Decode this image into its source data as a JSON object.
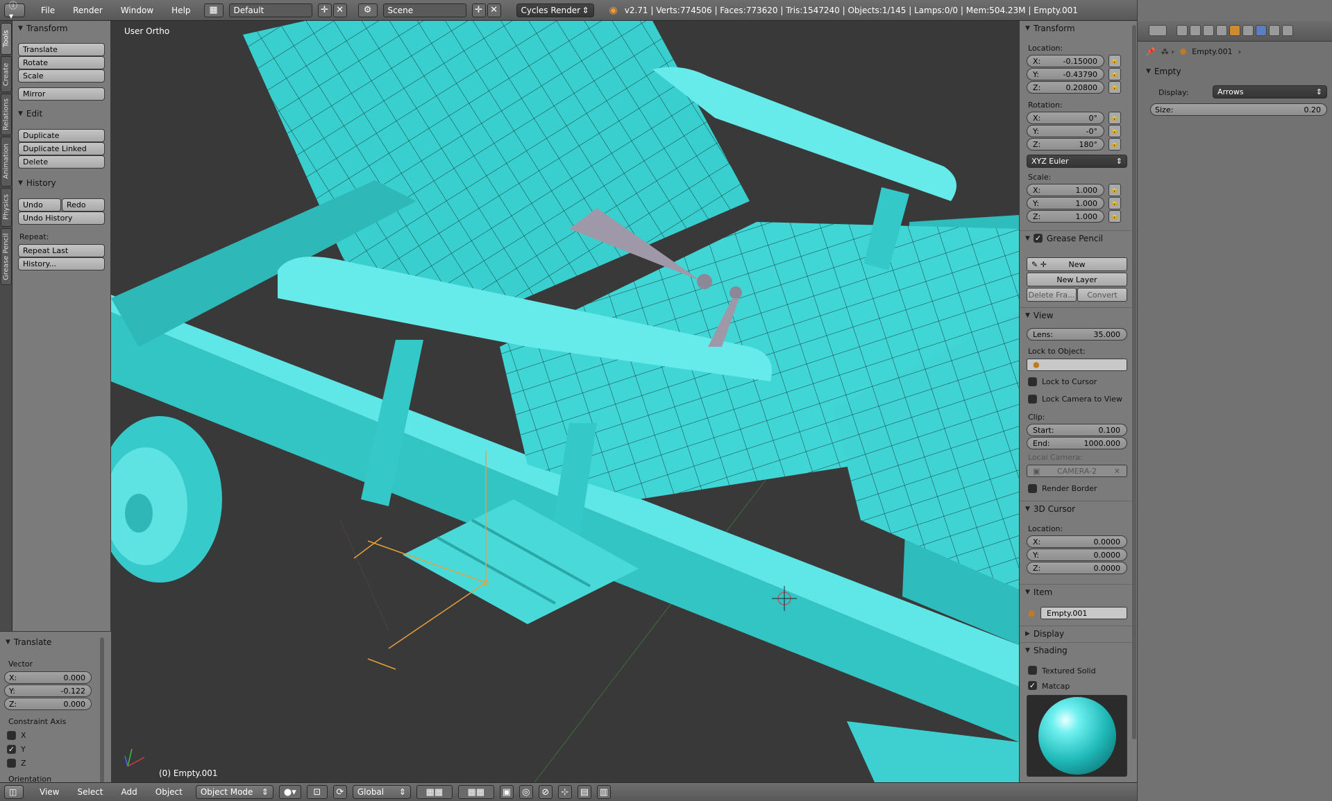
{
  "topbar": {
    "menus": [
      "File",
      "Render",
      "Window",
      "Help"
    ],
    "screen_layout": "Default",
    "scene": "Scene",
    "render_engine": "Cycles Render",
    "stats": "v2.71 | Verts:774506 | Faces:773620 | Tris:1547240 | Objects:1/145 | Lamps:0/0 | Mem:504.23M | Empty.001"
  },
  "tabstrip": [
    "Tools",
    "Create",
    "Relations",
    "Animation",
    "Physics",
    "Grease Pencil"
  ],
  "toolshelf": {
    "transform_title": "Transform",
    "translate": "Translate",
    "rotate": "Rotate",
    "scale": "Scale",
    "mirror": "Mirror",
    "edit_title": "Edit",
    "duplicate": "Duplicate",
    "duplicate_linked": "Duplicate Linked",
    "delete": "Delete",
    "history_title": "History",
    "undo": "Undo",
    "redo": "Redo",
    "undo_history": "Undo History",
    "repeat_label": "Repeat:",
    "repeat_last": "Repeat Last",
    "history_more": "History..."
  },
  "redo_panel": {
    "title": "Translate",
    "vector_label": "Vector",
    "x": {
      "label": "X:",
      "value": "0.000"
    },
    "y": {
      "label": "Y:",
      "value": "-0.122"
    },
    "z": {
      "label": "Z:",
      "value": "0.000"
    },
    "constraint_label": "Constraint Axis",
    "axes": [
      {
        "label": "X",
        "checked": false
      },
      {
        "label": "Y",
        "checked": true
      },
      {
        "label": "Z",
        "checked": false
      }
    ],
    "orientation_label": "Orientation"
  },
  "viewport": {
    "view_name": "User Ortho",
    "object_label": "(0) Empty.001",
    "mesh_color": "#3fd8d8"
  },
  "bottombar": {
    "menus": [
      "View",
      "Select",
      "Add",
      "Object"
    ],
    "mode": "Object Mode",
    "orientation": "Global"
  },
  "npanel": {
    "transform_title": "Transform",
    "location_label": "Location:",
    "loc": {
      "x": "-0.15000",
      "y": "-0.43790",
      "z": "0.20800"
    },
    "rotation_label": "Rotation:",
    "rot": {
      "x": "0°",
      "y": "-0°",
      "z": "180°"
    },
    "euler": "XYZ Euler",
    "scale_label": "Scale:",
    "scale": {
      "x": "1.000",
      "y": "1.000",
      "z": "1.000"
    },
    "grease_title": "Grease Pencil",
    "gp_new": "New",
    "gp_new_layer": "New Layer",
    "gp_delete": "Delete Fra...",
    "gp_convert": "Convert",
    "view_title": "View",
    "lens_label": "Lens:",
    "lens_value": "35.000",
    "lock_obj_label": "Lock to Object:",
    "lock_cursor": "Lock to Cursor",
    "lock_camera": "Lock Camera to View",
    "clip_label": "Clip:",
    "clip_start_label": "Start:",
    "clip_start": "0.100",
    "clip_end_label": "End:",
    "clip_end": "1000.000",
    "local_camera_label": "Local Camera:",
    "local_camera": "CAMERA-2",
    "render_border": "Render Border",
    "cursor_title": "3D Cursor",
    "cursor_location_label": "Location:",
    "cursor": {
      "x": "0.0000",
      "y": "0.0000",
      "z": "0.0000"
    },
    "item_title": "Item",
    "item_name": "Empty.001",
    "display_title": "Display",
    "shading_title": "Shading",
    "textured_solid": "Textured Solid",
    "matcap": "Matcap"
  },
  "props": {
    "breadcrumb": "Empty.001",
    "empty_title": "Empty",
    "display_label": "Display:",
    "display_value": "Arrows",
    "size_label": "Size:",
    "size_value": "0.20"
  }
}
